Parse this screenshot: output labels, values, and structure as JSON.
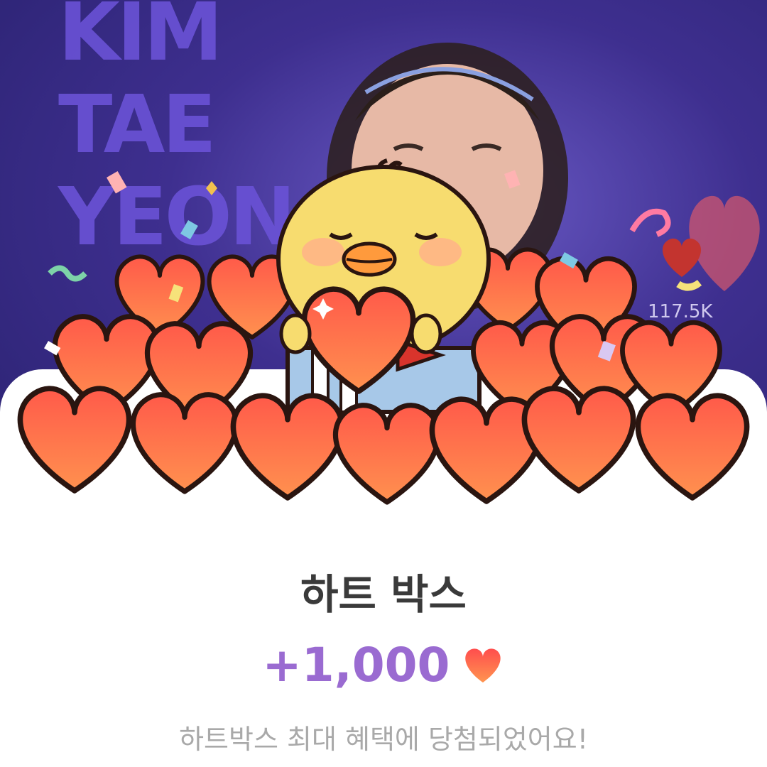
{
  "background": {
    "words": [
      "KIM",
      "TAE",
      "YEON"
    ],
    "like_count": "117.5K"
  },
  "reward": {
    "title": "하트 박스",
    "amount": "+1,000",
    "message": "하트박스 최대 혜택에 당첨되었어요!"
  },
  "colors": {
    "accent": "#9a6bd1",
    "heart_top": "#ff5a4a",
    "heart_bottom": "#ff8f4f",
    "mascot": "#f7dc6f"
  },
  "icons": [
    "heart-icon",
    "chick-mascot-icon",
    "gift-box-icon",
    "sparkle-icon"
  ]
}
